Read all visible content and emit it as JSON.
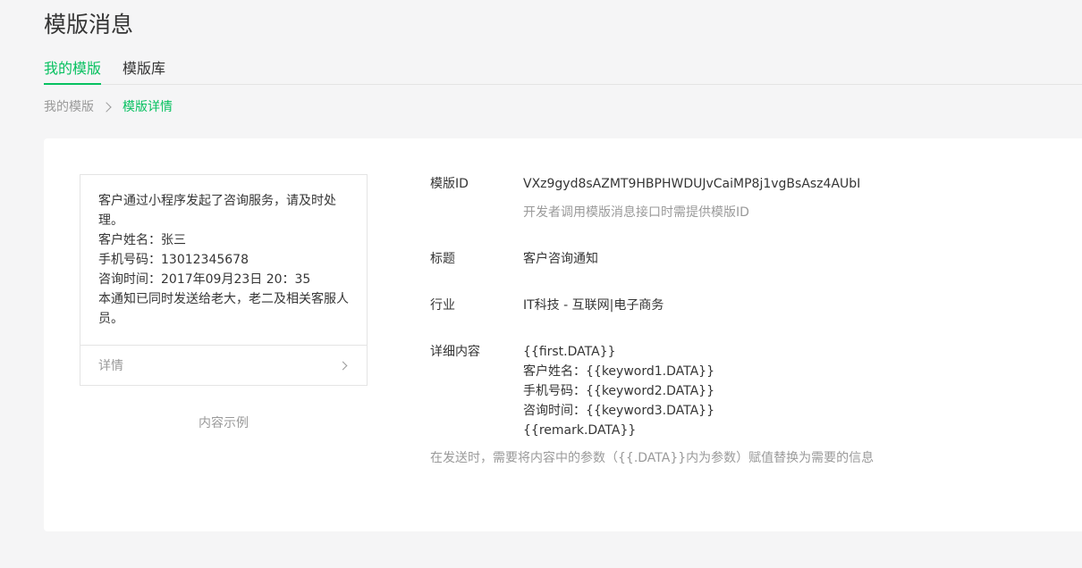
{
  "page": {
    "title": "模版消息"
  },
  "tabs": [
    {
      "label": "我的模版"
    },
    {
      "label": "模版库"
    }
  ],
  "breadcrumb": {
    "parent": "我的模版",
    "current": "模版详情"
  },
  "preview": {
    "lines": [
      "客户通过小程序发起了咨询服务，请及时处理。",
      "客户姓名：张三",
      "手机号码：13012345678",
      "咨询时间：2017年09月23日 20：35",
      "本通知已同时发送给老大，老二及相关客服人员。"
    ],
    "detail_link": "详情",
    "caption": "内容示例"
  },
  "details": {
    "template_id": {
      "label": "模版ID",
      "value": "VXz9gyd8sAZMT9HBPHWDUJvCaiMP8j1vgBsAsz4AUbI",
      "note": "开发者调用模版消息接口时需提供模版ID"
    },
    "title": {
      "label": "标题",
      "value": "客户咨询通知"
    },
    "industry": {
      "label": "行业",
      "value": "IT科技 - 互联网|电子商务"
    },
    "content": {
      "label": "详细内容",
      "lines": [
        "{{first.DATA}}",
        "客户姓名：{{keyword1.DATA}}",
        "手机号码：{{keyword2.DATA}}",
        "咨询时间：{{keyword3.DATA}}",
        "{{remark.DATA}}"
      ]
    },
    "footer_note": "在发送时，需要将内容中的参数（{{.DATA}}内为参数）赋值替换为需要的信息"
  },
  "colors": {
    "accent": "#07c160",
    "text": "#353535",
    "muted": "#9a9a9a",
    "background": "#f5f5f6"
  }
}
